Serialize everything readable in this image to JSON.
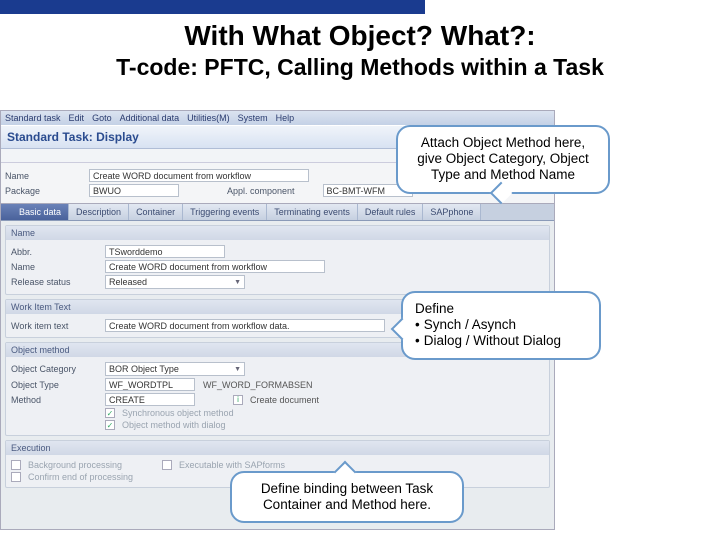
{
  "slide": {
    "title": "With What Object? What?:",
    "subtitle": "T-code: PFTC, Calling Methods within a Task"
  },
  "sap": {
    "menu": {
      "m0": "Standard task",
      "m1": "Edit",
      "m2": "Goto",
      "m3": "Additional data",
      "m4": "Utilities(M)",
      "m5": "System",
      "m6": "Help"
    },
    "title": "Standard Task: Display",
    "header": {
      "name_lbl": "Name",
      "name_val": "Create WORD document from workflow",
      "pkg_lbl": "Package",
      "pkg_val": "BWUO",
      "appl_lbl": "Appl. component",
      "appl_val": "BC-BMT-WFM"
    },
    "tabs": {
      "t0": "Basic data",
      "t1": "Description",
      "t2": "Container",
      "t3": "Triggering events",
      "t4": "Terminating events",
      "t5": "Default rules",
      "t6": "SAPphone"
    },
    "group_name": {
      "hdr": "Name",
      "abbr_lbl": "Abbr.",
      "abbr_val": "TSworddemo",
      "name_lbl": "Name",
      "name_val": "Create WORD document from workflow",
      "rel_lbl": "Release status",
      "rel_val": "Released"
    },
    "group_wit": {
      "hdr": "Work Item Text",
      "wit_lbl": "Work item text",
      "wit_val": "Create WORD document from workflow data."
    },
    "group_obj": {
      "hdr": "Object method",
      "cat_lbl": "Object Category",
      "cat_val": "BOR Object Type",
      "type_lbl": "Object Type",
      "type_val": "WF_WORDTPL",
      "type_desc": "WF_WORD_FORMABSEN",
      "meth_lbl": "Method",
      "meth_val": "CREATE",
      "meth_desc": "Create document",
      "chk1": "Synchronous object method",
      "chk2": "Object method with dialog"
    },
    "group_exec": {
      "hdr": "Execution",
      "chk1": "Background processing",
      "chk2": "Executable with SAPforms",
      "chk3": "Confirm end of processing"
    }
  },
  "callouts": {
    "c1": "Attach Object Method here, give Object Category, Object Type and Method Name",
    "c2_title": "  Define",
    "c2_b1": "Synch / Asynch",
    "c2_b2": "Dialog / Without Dialog",
    "c3": "Define binding between Task Container and Method here."
  }
}
